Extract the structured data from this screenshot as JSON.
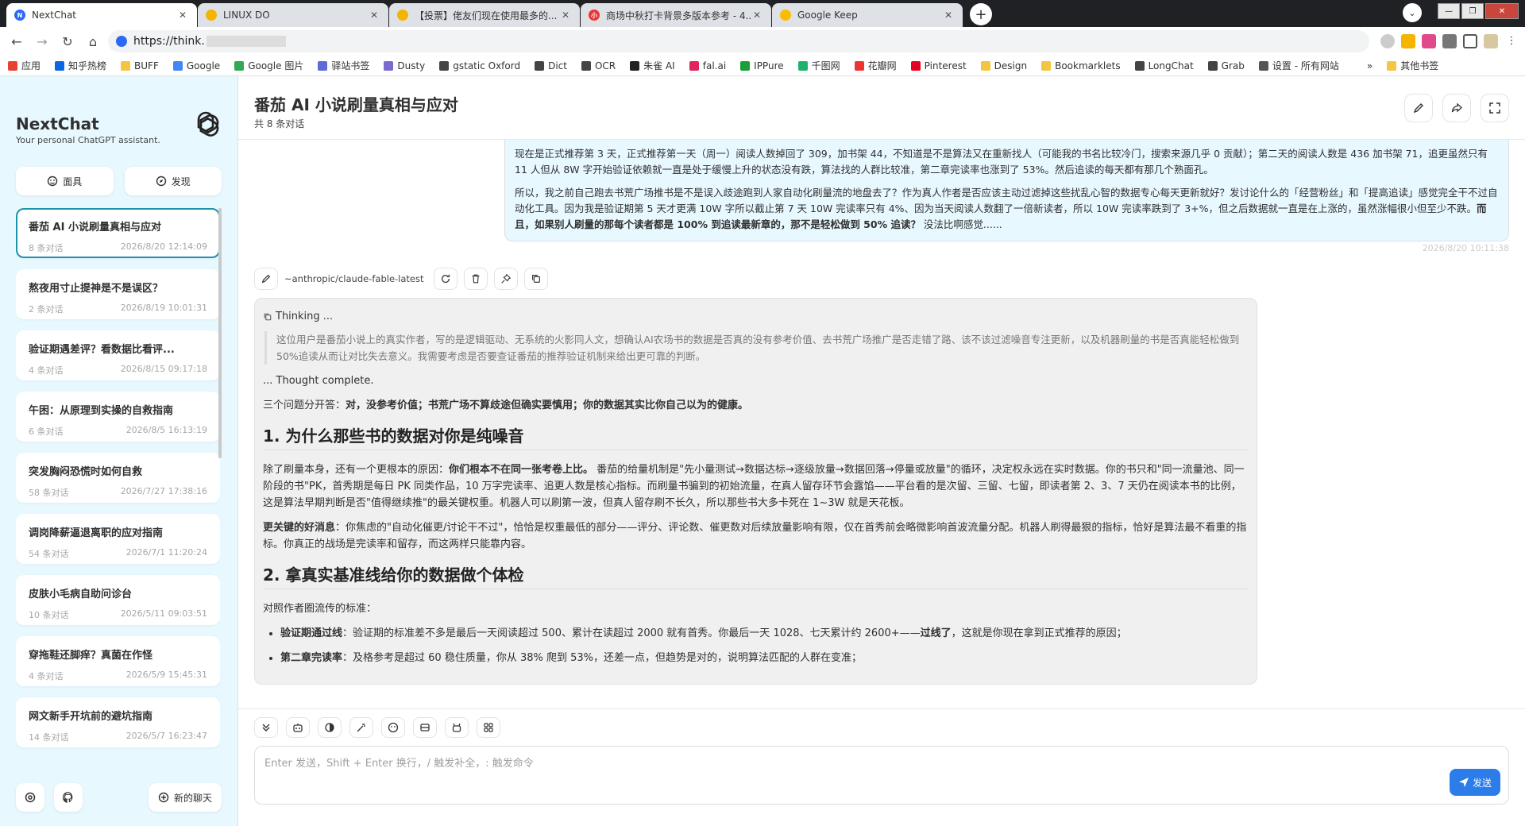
{
  "browser": {
    "tabs": [
      {
        "title": "NextChat",
        "fav_color": "#2b6bf3",
        "fav_text": "N"
      },
      {
        "title": "LINUX DO",
        "fav_color": "#f5b400",
        "fav_text": ""
      },
      {
        "title": "【投票】佬友们现在使用最多的...",
        "fav_color": "#f5b400",
        "fav_text": ""
      },
      {
        "title": "商场中秋打卡背景多版本参考 - 4...",
        "fav_color": "#e33",
        "fav_text": "小"
      },
      {
        "title": "Google Keep",
        "fav_color": "#fbbc04",
        "fav_text": ""
      }
    ],
    "url": "https://think."
  },
  "bookmarks": [
    {
      "label": "应用",
      "color": "#e94235"
    },
    {
      "label": "知乎热榜",
      "color": "#0a66e4"
    },
    {
      "label": "BUFF",
      "color": "#f4c542"
    },
    {
      "label": "Google",
      "color": "#4285f4"
    },
    {
      "label": "Google 图片",
      "color": "#34a853"
    },
    {
      "label": "驿站书签",
      "color": "#5b6bd8"
    },
    {
      "label": "Dusty",
      "color": "#7b6bd0"
    },
    {
      "label": "gstatic Oxford",
      "color": "#444"
    },
    {
      "label": "Dict",
      "color": "#444"
    },
    {
      "label": "OCR",
      "color": "#444"
    },
    {
      "label": "朱雀 AI",
      "color": "#222"
    },
    {
      "label": "fal.ai",
      "color": "#e0245e"
    },
    {
      "label": "IPPure",
      "color": "#1a9e3a"
    },
    {
      "label": "千图网",
      "color": "#20b26b"
    },
    {
      "label": "花瓣网",
      "color": "#e33"
    },
    {
      "label": "Pinterest",
      "color": "#e60023"
    },
    {
      "label": "Design",
      "color": "#f4c542"
    },
    {
      "label": "Bookmarklets",
      "color": "#f4c542"
    },
    {
      "label": "LongChat",
      "color": "#444"
    },
    {
      "label": "Grab",
      "color": "#444"
    },
    {
      "label": "设置 - 所有网站",
      "color": "#555"
    },
    {
      "label": "»",
      "color": "transparent"
    },
    {
      "label": "其他书签",
      "color": "#f4c542"
    }
  ],
  "sidebar": {
    "title": "NextChat",
    "subtitle": "Your personal ChatGPT assistant.",
    "mask_label": "面具",
    "discover_label": "发现",
    "new_chat_label": "新的聊天",
    "chats": [
      {
        "title": "番茄 AI 小说刷量真相与应对",
        "count": "8 条对话",
        "date": "2026/8/20 12:14:09",
        "active": true
      },
      {
        "title": "熬夜用寸止提神是不是误区？",
        "count": "2 条对话",
        "date": "2026/8/19 10:01:31"
      },
      {
        "title": "验证期遇差评？看数据比看评...",
        "count": "4 条对话",
        "date": "2026/8/15 09:17:18"
      },
      {
        "title": "午困：从原理到实操的自救指南",
        "count": "6 条对话",
        "date": "2026/8/5 16:13:19"
      },
      {
        "title": "突发胸闷恐慌时如何自救",
        "count": "58 条对话",
        "date": "2026/7/27 17:38:16"
      },
      {
        "title": "调岗降薪逼退离职的应对指南",
        "count": "54 条对话",
        "date": "2026/7/1 11:20:24"
      },
      {
        "title": "皮肤小毛病自助问诊台",
        "count": "10 条对话",
        "date": "2026/5/11 09:03:51"
      },
      {
        "title": "穿拖鞋还脚痒？真菌在作怪",
        "count": "4 条对话",
        "date": "2026/5/9 15:45:31"
      },
      {
        "title": "网文新手开坑前的避坑指南",
        "count": "14 条对话",
        "date": "2026/5/7 16:23:47"
      }
    ]
  },
  "header": {
    "title": "番茄 AI 小说刷量真相与应对",
    "subtitle": "共 8 条对话"
  },
  "user_message": {
    "p1": "现在是正式推荐第 3 天，正式推荐第一天（周一）阅读人数掉回了 309，加书架 44，不知道是不是算法又在重新找人（可能我的书名比较冷门，搜索来源几乎 0 贡献）；第二天的阅读人数是 436 加书架 71，追更虽然只有 11 人但从 8W 字开始验证依赖就一直是处于缓慢上升的状态没有跌，算法找的人群比较准，第二章完读率也涨到了 53%。然后追读的每天都有那几个熟面孔。",
    "p2_a": "所以，我之前自己跑去书荒广场推书是不是误入歧途跑到人家自动化刷量流的地盘去了？作为真人作者是否应该主动过滤掉这些扰乱心智的数据专心每天更新就好？发讨论什么的「经营粉丝」和「提高追读」感觉完全干不过自动化工具。因为我是验证期第 5 天才更满 10W 字所以截止第 7 天 10W 完读率只有 4%、因为当天阅读人数翻了一倍新读者，所以 10W 完读率跌到了 3+%，但之后数据就一直是在上涨的，虽然涨幅很小但至少不跌。",
    "p2_b": "而且，如果别人刷量的那每个读者都是 100% 到追读最新章的，那不是轻松做到 50% 追读？",
    "p2_c": " 没法比啊感觉......",
    "date": "2026/8/20 10:11:38"
  },
  "bot_message": {
    "model": "~anthropic/claude-fable-latest",
    "thinking_label": "Thinking ...",
    "thinking_text": "这位用户是番茄小说上的真实作者，写的是逻辑驱动、无系统的火影同人文，想确认AI农场书的数据是否真的没有参考价值、去书荒广场推广是否走错了路、该不该过滤噪音专注更新，以及机器刷量的书是否真能轻松做到50%追读从而让对比失去意义。我需要考虑是否要查证番茄的推荐验证机制来给出更可靠的判断。",
    "thought_complete": "... Thought complete.",
    "intro_a": "三个问题分开答：",
    "intro_b": "对，没参考价值；书荒广场不算歧途但确实要慎用；你的数据其实比你自己以为的健康。",
    "h1": "1. 为什么那些书的数据对你是纯噪音",
    "s1p1_a": "除了刷量本身，还有一个更根本的原因：",
    "s1p1_b": "你们根本不在同一张考卷上比。",
    "s1p1_c": " 番茄的给量机制是\"先小量测试→数据达标→逐级放量→数据回落→停量或放量\"的循环，决定权永远在实时数据。你的书只和\"同一流量池、同一阶段的书\"PK，首秀期是每日 PK 同类作品，10 万字完读率、追更人数是核心指标。而刷量书骗到的初始流量，在真人留存环节会露馅——平台看的是次留、三留、七留，即读者第 2、3、7 天仍在阅读本书的比例，这是算法早期判断是否\"值得继续推\"的最关键权重。机器人可以刷第一波，但真人留存刷不长久，所以那些书大多卡死在 1~3W 就是天花板。",
    "s1p2_a": "更关键的好消息",
    "s1p2_b": "：你焦虑的\"自动化催更/讨论干不过\"，恰恰是权重最低的部分——评分、评论数、催更数对后续放量影响有限，仅在首秀前会略微影响首波流量分配。机器人刷得最狠的指标，恰好是算法最不看重的指标。你真正的战场是完读率和留存，而这两样只能靠内容。",
    "h2": "2. 拿真实基准线给你的数据做个体检",
    "s2p1": "对照作者圈流传的标准：",
    "li1_a": "验证期通过线",
    "li1_b": "：验证期的标准差不多是最后一天阅读超过 500、累计在读超过 2000 就有首秀。你最后一天 1028、七天累计约 2600+——",
    "li1_c": "过线了",
    "li1_d": "，这就是你现在拿到正式推荐的原因；",
    "li2_a": "第二章完读率",
    "li2_b": "：及格参考是超过 60 稳住质量，你从 38% 爬到 53%，还差一点，但趋势是对的，说明算法匹配的人群在变准；"
  },
  "input": {
    "placeholder": "Enter 发送，Shift + Enter 换行，/ 触发补全，: 触发命令",
    "send_label": "发送"
  },
  "colors": {
    "accent": "#1d93ab",
    "sidebar_bg": "#e7f8ff",
    "send_bg": "#2b7de9"
  }
}
